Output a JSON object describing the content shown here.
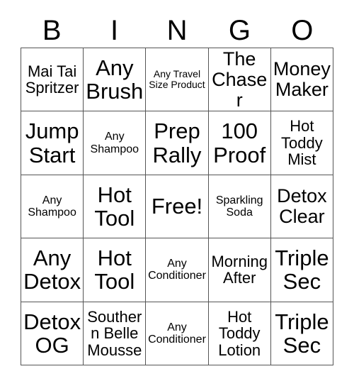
{
  "card": {
    "title": "BINGO",
    "headers": [
      "B",
      "I",
      "N",
      "G",
      "O"
    ],
    "free_space_label": "Free!",
    "columns": {
      "B": [
        "Mai Tai Spritzer",
        "Jump Start",
        "Any Shampoo",
        "Any Detox",
        "Detox OG"
      ],
      "I": [
        "Any Brush",
        "Any Shampoo",
        "Hot Tool",
        "Hot Tool",
        "Southern Belle Mousse"
      ],
      "N": [
        "Any Travel Size Product",
        "Prep Rally",
        "Free!",
        "Any Conditioner",
        "Any Conditioner"
      ],
      "G": [
        "The Chaser",
        "100 Proof",
        "Sparkling Soda",
        "Morning After",
        "Hot Toddy Lotion"
      ],
      "O": [
        "Money Maker",
        "Hot Toddy Mist",
        "Detox Clear",
        "Triple Sec",
        "Triple Sec"
      ]
    },
    "rows": [
      [
        "Mai Tai Spritzer",
        "Any Brush",
        "Any Travel Size Product",
        "The Chaser",
        "Money Maker"
      ],
      [
        "Jump Start",
        "Any Shampoo",
        "Prep Rally",
        "100 Proof",
        "Hot Toddy Mist"
      ],
      [
        "Any Shampoo",
        "Hot Tool",
        "Free!",
        "Sparkling Soda",
        "Detox Clear"
      ],
      [
        "Any Detox",
        "Hot Tool",
        "Any Conditioner",
        "Morning After",
        "Triple Sec"
      ],
      [
        "Detox OG",
        "Southern Belle Mousse",
        "Any Conditioner",
        "Hot Toddy Lotion",
        "Triple Sec"
      ]
    ],
    "size_tiers": [
      [
        "sz-md",
        "sz-xl",
        "sz-xs",
        "sz-lg",
        "sz-lg"
      ],
      [
        "sz-xl",
        "sz-sm",
        "sz-xl",
        "sz-xl",
        "sz-md"
      ],
      [
        "sz-sm",
        "sz-xl",
        "sz-xl",
        "sz-sm",
        "sz-lg"
      ],
      [
        "sz-xl",
        "sz-xl",
        "sz-sm",
        "sz-md",
        "sz-xl"
      ],
      [
        "sz-xl",
        "sz-md",
        "sz-sm",
        "sz-md",
        "sz-xl"
      ]
    ],
    "colors": {
      "background": "#ffffff",
      "text": "#000000",
      "grid_line": "#555555"
    }
  }
}
